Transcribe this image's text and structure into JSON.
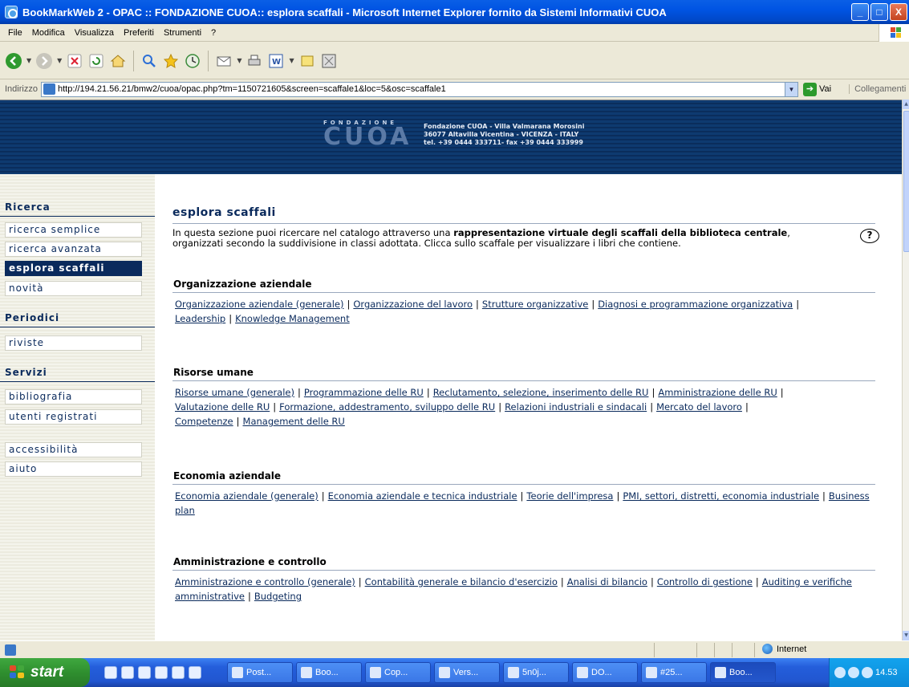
{
  "window": {
    "title": "BookMarkWeb 2 - OPAC :: FONDAZIONE CUOA:: esplora scaffali - Microsoft Internet Explorer fornito da Sistemi Informativi CUOA",
    "minimize": "_",
    "maximize": "□",
    "close": "X"
  },
  "menu": [
    "File",
    "Modifica",
    "Visualizza",
    "Preferiti",
    "Strumenti",
    "?"
  ],
  "address": {
    "label": "Indirizzo",
    "url": "http://194.21.56.21/bmw2/cuoa/opac.php?tm=1150721605&screen=scaffale1&loc=5&osc=scaffale1",
    "go": "Vai",
    "links": "Collegamenti"
  },
  "banner": {
    "logo_top": "FONDAZIONE",
    "logo_main": "CUOA",
    "line1": "Fondazione CUOA - Villa Valmarana Morosini",
    "line2": "36077 Altavilla Vicentina - VICENZA - ITALY",
    "line3": "tel. +39 0444 333711- fax +39 0444 333999"
  },
  "nav": {
    "ricerca_head": "Ricerca",
    "ricerca_semplice": "ricerca semplice",
    "ricerca_avanzata": "ricerca avanzata",
    "esplora_scaffali": "esplora scaffali",
    "novita": "novità",
    "periodici_head": "Periodici",
    "riviste": "riviste",
    "servizi_head": "Servizi",
    "bibliografia": "bibliografia",
    "utenti_registrati": "utenti registrati",
    "accessibilita": "accessibilità",
    "aiuto": "aiuto"
  },
  "content": {
    "title": "esplora scaffali",
    "intro_1": "In questa sezione puoi ricercare nel catalogo attraverso una ",
    "intro_bold": "rappresentazione virtuale degli scaffali della biblioteca centrale",
    "intro_2": ", organizzati secondo la suddivisione in classi adottata. Clicca sullo scaffale per visualizzare i libri che contiene.",
    "help": "?",
    "sections": [
      {
        "title": "Organizzazione aziendale",
        "links": [
          "Organizzazione aziendale (generale)",
          "Organizzazione del lavoro",
          "Strutture organizzative",
          "Diagnosi e programmazione organizzativa",
          "Leadership",
          "Knowledge Management"
        ]
      },
      {
        "title": "Risorse umane",
        "links": [
          "Risorse umane (generale)",
          "Programmazione delle RU",
          "Reclutamento, selezione, inserimento delle RU",
          "Amministrazione delle RU",
          "Valutazione delle RU",
          "Formazione, addestramento, sviluppo delle RU",
          "Relazioni industriali e sindacali",
          "Mercato del lavoro",
          "Competenze",
          "Management delle RU"
        ]
      },
      {
        "title": "Economia aziendale",
        "links": [
          "Economia aziendale (generale)",
          "Economia aziendale e tecnica industriale",
          "Teorie dell'impresa",
          "PMI, settori, distretti, economia industriale",
          "Business plan"
        ]
      },
      {
        "title": "Amministrazione e controllo",
        "links": [
          "Amministrazione e controllo (generale)",
          "Contabilità generale e bilancio d'esercizio",
          "Analisi di bilancio",
          "Controllo di gestione",
          "Auditing e verifiche amministrative",
          "Budgeting"
        ]
      }
    ]
  },
  "status": {
    "zone": "Internet"
  },
  "taskbar": {
    "start": "start",
    "tasks": [
      "Post...",
      "Boo...",
      "Cop...",
      "Vers...",
      "5n0j...",
      "DO...",
      "#25...",
      "Boo..."
    ],
    "clock": "14.53"
  },
  "colors": {
    "accent": "#0a2a5c",
    "banner": "#0e3a70",
    "link": "#0a2a5c"
  }
}
